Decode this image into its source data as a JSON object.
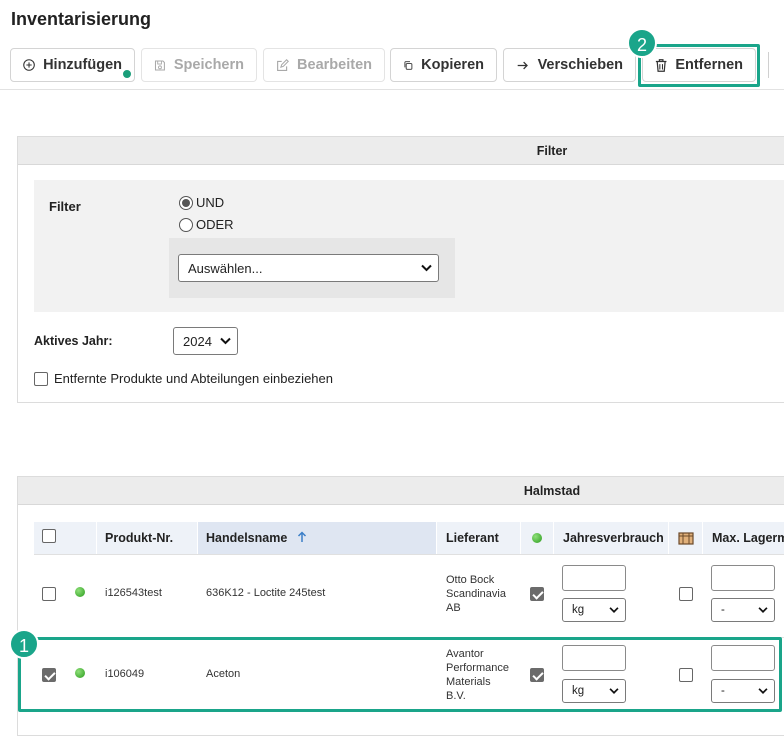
{
  "page": {
    "title": "Inventarisierung"
  },
  "toolbar": {
    "add": "Hinzufügen",
    "save": "Speichern",
    "edit": "Bearbeiten",
    "copy": "Kopieren",
    "move": "Verschieben",
    "remove": "Entfernen"
  },
  "filter_panel": {
    "header": "Filter",
    "filter_label": "Filter",
    "radio_and": "UND",
    "radio_or": "ODER",
    "radio_selected": "UND",
    "select_value": "Auswählen...",
    "active_year_label": "Aktives Jahr:",
    "active_year_value": "2024",
    "include_removed_label": "Entfernte Produkte und Abteilungen einbeziehen",
    "include_removed_checked": false
  },
  "table_panel": {
    "header": "Halmstad",
    "columns": [
      "Produkt-Nr.",
      "Handelsname",
      "Lieferant",
      "Jahresverbrauch",
      "Max. Lagerm"
    ],
    "sort_column": "Handelsname",
    "sort_direction": "ascending",
    "rows": [
      {
        "selected": false,
        "status": "green",
        "product_no": "i126543test",
        "trade_name": "636K12 - Loctite 245test",
        "supplier": [
          "Otto Bock",
          "Scandinavia",
          "AB"
        ],
        "approved": true,
        "annual_usage": "",
        "unit": "kg",
        "flag": false,
        "max_stock": "",
        "max_unit": "-"
      },
      {
        "selected": true,
        "status": "green",
        "product_no": "i106049",
        "trade_name": "Aceton",
        "supplier": [
          "Avantor",
          "Performance",
          "Materials",
          "B.V."
        ],
        "approved": true,
        "annual_usage": "",
        "unit": "kg",
        "flag": false,
        "max_stock": "",
        "max_unit": "-"
      }
    ]
  },
  "annotations": {
    "callout_1": "1",
    "callout_2": "2",
    "color": "#1aa58a"
  },
  "icons": [
    "plus-circle-icon",
    "save-icon",
    "edit-icon",
    "copy-icon",
    "arrow-right-icon",
    "trash-icon",
    "green-status-icon",
    "box-icon",
    "sort-up-icon",
    "chevron-down-icon"
  ]
}
